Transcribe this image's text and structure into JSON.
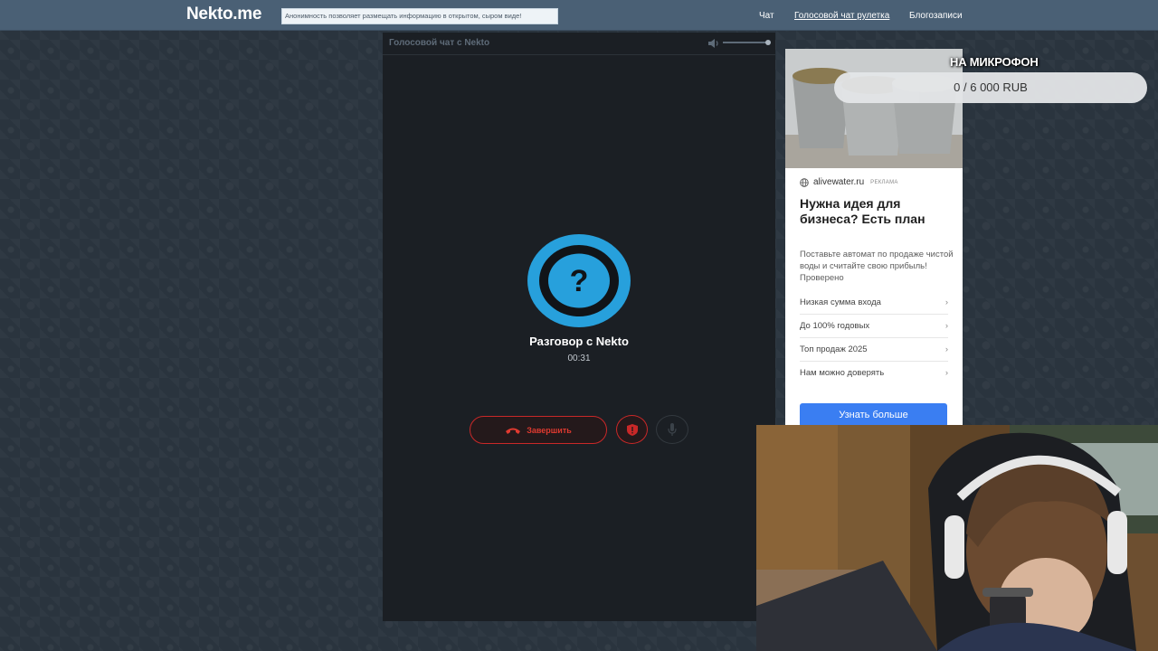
{
  "header": {
    "logo": "Nekto.me",
    "notice": "Анонимность позволяет размещать информацию в открытом, сыром виде!",
    "nav": {
      "chat": "Чат",
      "voice_roulette": "Голосовой чат рулетка",
      "blogs": "Блогозаписи"
    }
  },
  "chat": {
    "title": "Голосовой чат с Nekto",
    "avatar_glyph": "?",
    "conversation_title": "Разговор с Nekto",
    "timer": "00:31",
    "end_label": "Завершить",
    "volume_level": 1.0
  },
  "ad": {
    "source": "alivewater.ru",
    "label": "РЕКЛАМА",
    "title": "Нужна идея для бизнеса? Есть план",
    "description": "Поставьте автомат по продаже чистой воды и считайте свою прибыль! Проверено",
    "items": [
      {
        "label": "Низкая сумма входа"
      },
      {
        "label": "До 100% годовых"
      },
      {
        "label": "Топ продаж 2025"
      },
      {
        "label": "Нам можно доверять"
      }
    ],
    "cta": "Узнать больше"
  },
  "donation": {
    "title": "НА МИКРОФОН",
    "progress": "0 / 6 000 RUB"
  },
  "colors": {
    "topbar": "#4a6075",
    "accent_blue": "#27a0dc",
    "danger_red": "#c92828",
    "ad_cta": "#3a7ef2"
  },
  "icons": {
    "volume": "speaker-icon",
    "end_call": "phone-hangup-icon",
    "report": "shield-icon",
    "mute": "microphone-icon",
    "chevron": "chevron-right-icon",
    "ad_source": "globe-icon"
  }
}
